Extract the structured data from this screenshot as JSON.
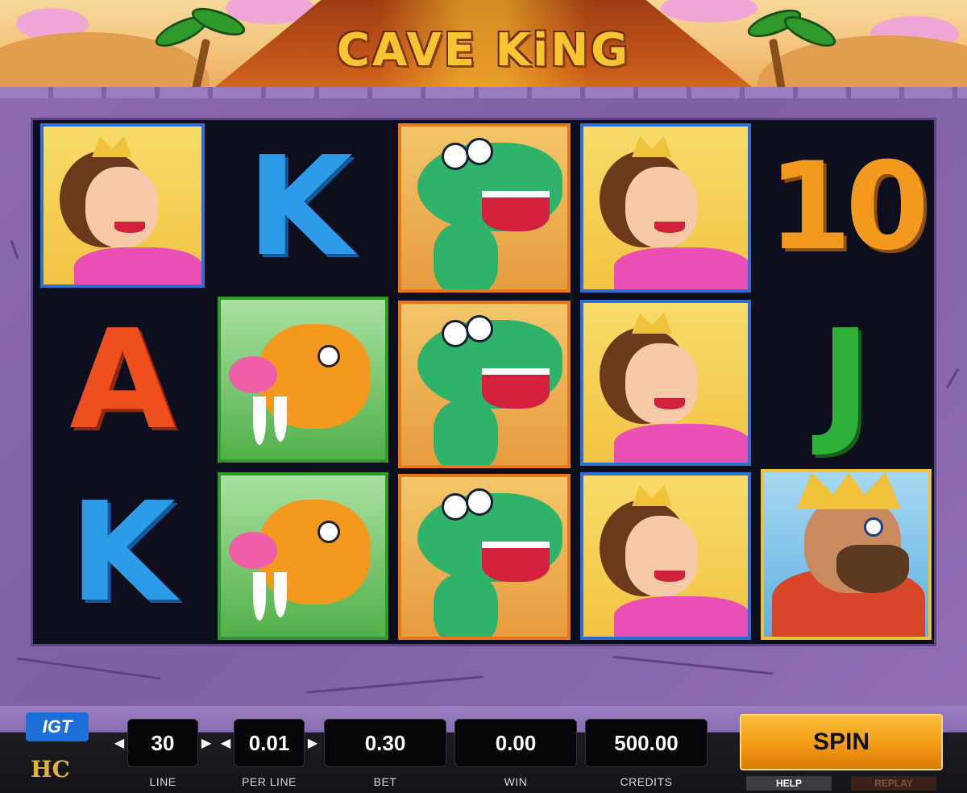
{
  "game": {
    "title": "CAVE KiNG",
    "brand_logo": "IGT",
    "studio_logo": "HC"
  },
  "reels": [
    [
      "queen",
      "letter-a",
      "letter-k"
    ],
    [
      "letter-k",
      "sabertooth",
      "sabertooth"
    ],
    [
      "dinosaur",
      "dinosaur",
      "dinosaur"
    ],
    [
      "queen",
      "queen",
      "queen"
    ],
    [
      "letter-10",
      "letter-j",
      "cave-king"
    ]
  ],
  "symbols": {
    "k": "K",
    "a": "A",
    "j": "J",
    "ten": "10"
  },
  "controls": {
    "line": {
      "value": "30",
      "label": "LINE"
    },
    "per_line": {
      "value": "0.01",
      "label": "PER LINE"
    },
    "bet": {
      "value": "0.30",
      "label": "BET"
    },
    "win": {
      "value": "0.00",
      "label": "WIN"
    },
    "credits": {
      "value": "500.00",
      "label": "CREDITS"
    },
    "spin_label": "SPIN",
    "help_label": "HELP",
    "replay_label": "REPLAY",
    "decrease_arrow": "◀",
    "increase_arrow": "▶"
  },
  "colors": {
    "frame": "#8a6cb2",
    "spin_button": "#f39a14",
    "queen_border": "#2f6fd1",
    "dino_border": "#e8791a",
    "cat_border": "#2f9a2a",
    "king_border": "#f0c23b"
  }
}
